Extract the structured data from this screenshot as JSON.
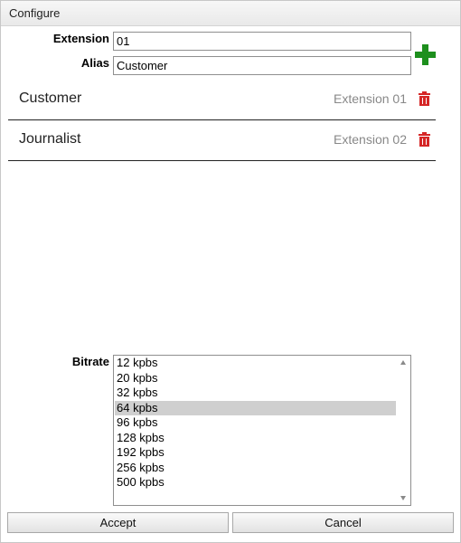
{
  "dialog": {
    "title": "Configure"
  },
  "form": {
    "extension_label": "Extension",
    "extension_value": "01",
    "alias_label": "Alias",
    "alias_value": "Customer",
    "add_icon": "plus-icon",
    "add_color": "#1d8f1d"
  },
  "aliases": [
    {
      "name": "Customer",
      "extension": "Extension 01",
      "delete_icon": "trash-icon"
    },
    {
      "name": "Journalist",
      "extension": "Extension 02",
      "delete_icon": "trash-icon"
    }
  ],
  "bitrate": {
    "label": "Bitrate",
    "options": [
      "12 kpbs",
      "20 kpbs",
      "32 kpbs",
      "64 kpbs",
      "96 kpbs",
      "128 kpbs",
      "192 kpbs",
      "256 kpbs",
      "500 kpbs"
    ],
    "selected": "64 kpbs",
    "selected_color": "#cfcfcf"
  },
  "buttons": {
    "accept": "Accept",
    "cancel": "Cancel"
  },
  "colors": {
    "delete_icon": "#d52626",
    "secondary_text": "#888888"
  }
}
